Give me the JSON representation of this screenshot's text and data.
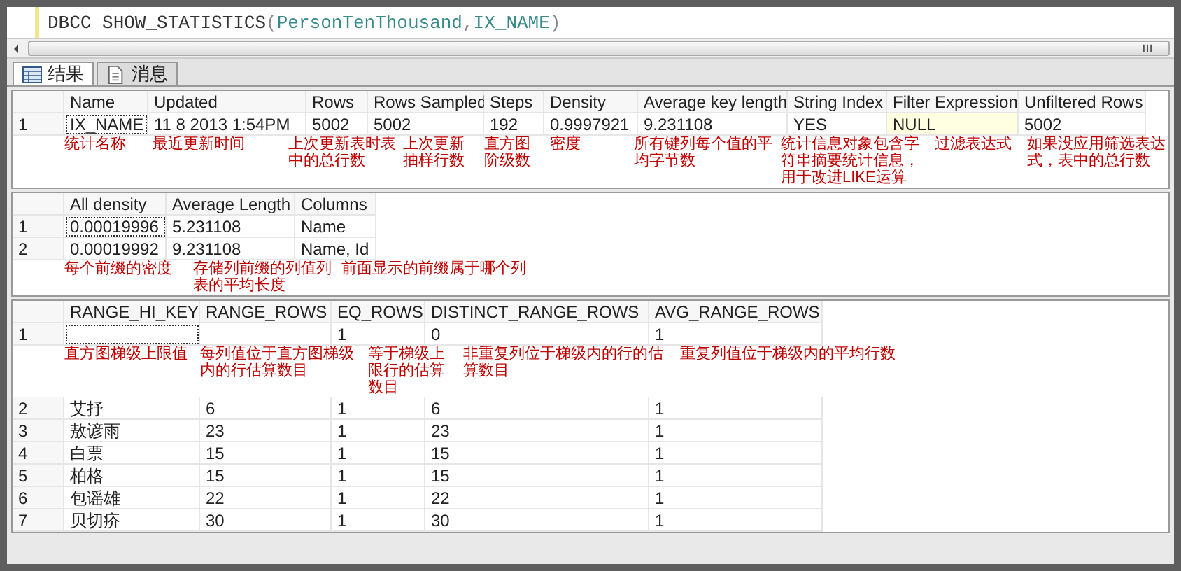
{
  "editor": {
    "tokens": [
      {
        "text": "DBCC",
        "kind": "keyword"
      },
      {
        "text": " SHOW_STATISTICS",
        "kind": "function"
      },
      {
        "text": "(",
        "kind": "operator"
      },
      {
        "text": "PersonTenThousand",
        "kind": "identifier"
      },
      {
        "text": ",",
        "kind": "operator"
      },
      {
        "text": "IX_NAME",
        "kind": "identifier"
      },
      {
        "text": ")",
        "kind": "operator"
      }
    ]
  },
  "tabs": [
    {
      "label": "结果",
      "selected": true
    },
    {
      "label": "消息",
      "selected": false
    }
  ],
  "result_sets": [
    {
      "columns": [
        "Name",
        "Updated",
        "Rows",
        "Rows Sampled",
        "Steps",
        "Density",
        "Average key length",
        "String Index",
        "Filter Expression",
        "Unfiltered Rows"
      ],
      "rows": [
        {
          "number": "1",
          "cells": [
            {
              "text": "IX_NAME",
              "selected": true
            },
            {
              "text": "11 8 2013  1:54PM",
              "selected": false
            },
            {
              "text": "5002",
              "selected": false
            },
            {
              "text": "5002",
              "selected": false
            },
            {
              "text": "192",
              "selected": false
            },
            {
              "text": "0.9997921",
              "selected": false
            },
            {
              "text": "9.231108",
              "selected": false
            },
            {
              "text": "YES",
              "selected": false
            },
            {
              "text": "NULL",
              "selected": false,
              "kind": "null"
            },
            {
              "text": "5002",
              "selected": false
            }
          ]
        }
      ],
      "annotations": [
        "统计名称",
        "最近更新时间",
        "上次更新表时表中的总行数",
        "上次更新抽样行数",
        "直方图阶级数",
        "密度",
        "所有键列每个值的平均字节数",
        "统计信息对象包含字符串摘要统计信息，用于改进LIKE运算",
        "过滤表达式",
        "如果没应用筛选表达式，表中的总行数"
      ]
    },
    {
      "columns": [
        "All density",
        "Average Length",
        "Columns"
      ],
      "rows": [
        {
          "number": "1",
          "cells": [
            {
              "text": "0.00019996",
              "selected": true
            },
            {
              "text": "5.231108",
              "selected": false
            },
            {
              "text": "Name",
              "selected": false
            }
          ]
        },
        {
          "number": "2",
          "cells": [
            {
              "text": "0.00019992",
              "selected": false
            },
            {
              "text": "9.231108",
              "selected": false
            },
            {
              "text": "Name, Id",
              "selected": false
            }
          ]
        }
      ],
      "annotations": [
        "每个前缀的密度",
        "存储列前缀的列值列表的平均长度",
        "前面显示的前缀属于哪个列"
      ]
    },
    {
      "columns": [
        "RANGE_HI_KEY",
        "RANGE_ROWS",
        "EQ_ROWS",
        "DISTINCT_RANGE_ROWS",
        "AVG_RANGE_ROWS"
      ],
      "rows": [
        {
          "number": "1",
          "cells": [
            {
              "text": null,
              "selected": true
            },
            {
              "text": null,
              "selected": false
            },
            {
              "text": "1",
              "selected": false
            },
            {
              "text": "0",
              "selected": false
            },
            {
              "text": "1",
              "selected": false
            }
          ]
        },
        {
          "number": "2",
          "cells": [
            {
              "text": "艾抒",
              "selected": false
            },
            {
              "text": "6",
              "selected": false
            },
            {
              "text": "1",
              "selected": false
            },
            {
              "text": "6",
              "selected": false
            },
            {
              "text": "1",
              "selected": false
            }
          ]
        },
        {
          "number": "3",
          "cells": [
            {
              "text": "敖谚雨",
              "selected": false
            },
            {
              "text": "23",
              "selected": false
            },
            {
              "text": "1",
              "selected": false
            },
            {
              "text": "23",
              "selected": false
            },
            {
              "text": "1",
              "selected": false
            }
          ]
        },
        {
          "number": "4",
          "cells": [
            {
              "text": "白票",
              "selected": false
            },
            {
              "text": "15",
              "selected": false
            },
            {
              "text": "1",
              "selected": false
            },
            {
              "text": "15",
              "selected": false
            },
            {
              "text": "1",
              "selected": false
            }
          ]
        },
        {
          "number": "5",
          "cells": [
            {
              "text": "柏格",
              "selected": false
            },
            {
              "text": "15",
              "selected": false
            },
            {
              "text": "1",
              "selected": false
            },
            {
              "text": "15",
              "selected": false
            },
            {
              "text": "1",
              "selected": false
            }
          ]
        },
        {
          "number": "6",
          "cells": [
            {
              "text": "包谣雄",
              "selected": false
            },
            {
              "text": "22",
              "selected": false
            },
            {
              "text": "1",
              "selected": false
            },
            {
              "text": "22",
              "selected": false
            },
            {
              "text": "1",
              "selected": false
            }
          ]
        },
        {
          "number": "7",
          "cells": [
            {
              "text": "贝切疥",
              "selected": false
            },
            {
              "text": "30",
              "selected": false
            },
            {
              "text": "1",
              "selected": false
            },
            {
              "text": "30",
              "selected": false
            },
            {
              "text": "1",
              "selected": false
            }
          ]
        }
      ],
      "annotations": [
        "直方图梯级上限值",
        "每列值位于直方图梯级内的行估算数目",
        "等于梯级上限行的估算数目",
        "非重复列位于梯级内的行的估算数目",
        "重复列值位于梯级内的平均行数"
      ]
    }
  ]
}
